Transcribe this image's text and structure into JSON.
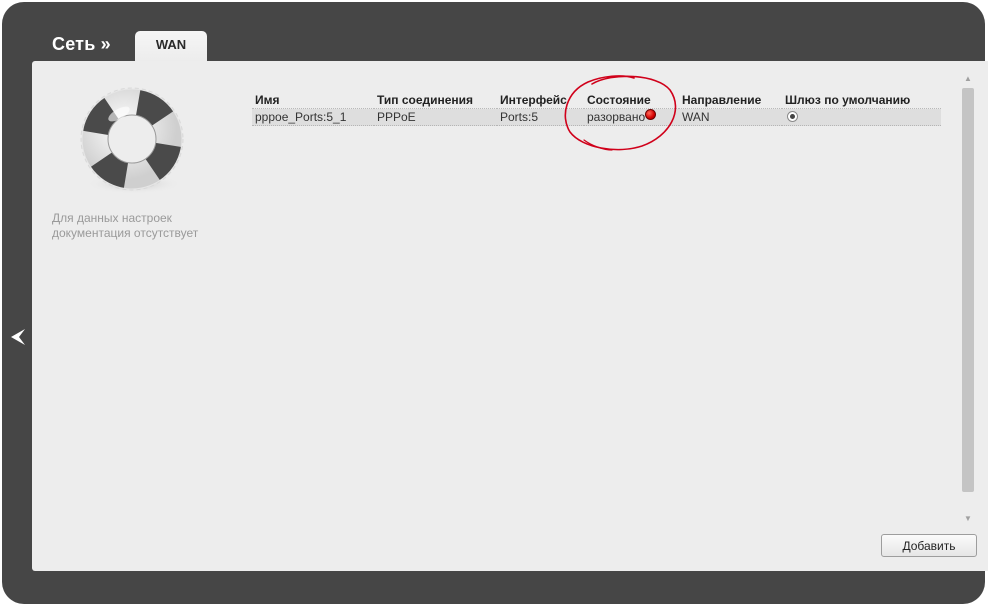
{
  "header": {
    "section_title": "Сеть »",
    "tab_label": "WAN"
  },
  "help": {
    "text": "Для данных настроек документация отсутствует"
  },
  "table": {
    "columns": [
      "Имя",
      "Тип соединения",
      "Интерфейс",
      "Состояние",
      "Направление",
      "Шлюз по умолчанию"
    ],
    "rows": [
      {
        "name": "pppoe_Ports:5_1",
        "type": "PPPoE",
        "interface": "Ports:5",
        "status": "разорвано",
        "status_color": "#e00000",
        "direction": "WAN",
        "default_gateway": "selected"
      }
    ]
  },
  "buttons": {
    "add_label": "Добавить"
  },
  "icons": {
    "back": "back-arrow-icon",
    "help": "lifebuoy-icon",
    "gateway": "radio-icon"
  },
  "colors": {
    "background": "#464646",
    "panel": "#ededed",
    "annotation": "#d0001a"
  }
}
